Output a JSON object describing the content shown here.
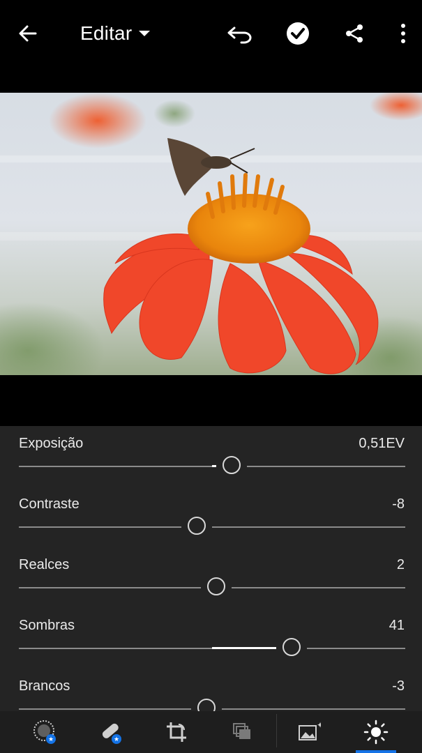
{
  "header": {
    "title": "Editar",
    "icons": [
      "back-arrow-icon",
      "chevron-down-icon",
      "undo-icon",
      "checkmark-icon",
      "share-icon",
      "more-vertical-icon"
    ]
  },
  "photo": {
    "description_icon": "flower-photo"
  },
  "adjustments": [
    {
      "label": "Exposição",
      "value": "0,51EV",
      "fraction": 0.55
    },
    {
      "label": "Contraste",
      "value": "-8",
      "fraction": 0.46
    },
    {
      "label": "Realces",
      "value": "2",
      "fraction": 0.51
    },
    {
      "label": "Sombras",
      "value": "41",
      "fraction": 0.705
    },
    {
      "label": "Brancos",
      "value": "-3",
      "fraction": 0.485
    }
  ],
  "toolbar": {
    "items": [
      "selective-icon",
      "healing-icon",
      "crop-icon",
      "versions-icon",
      "presets-icon",
      "light-icon"
    ],
    "active": "light-icon",
    "accent": "#1473e6"
  }
}
